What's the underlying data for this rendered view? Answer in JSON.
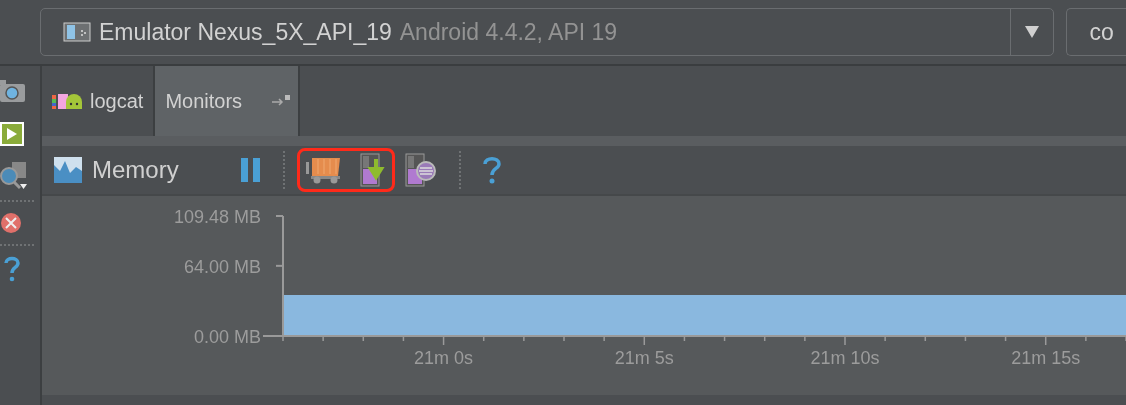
{
  "device_selector": {
    "name": "Emulator Nexus_5X_API_19",
    "detail": "Android 4.4.2, API 19"
  },
  "side_button": {
    "label": "co"
  },
  "tabs": [
    {
      "label": "logcat",
      "kind": "logcat",
      "selected": false
    },
    {
      "label": "Monitors",
      "kind": "monitors",
      "selected": true
    }
  ],
  "monitor": {
    "title": "Memory",
    "tools": [
      {
        "kind": "pause",
        "highlighted": false
      },
      {
        "kind": "gc",
        "highlighted": true
      },
      {
        "kind": "dump",
        "highlighted": true
      },
      {
        "kind": "alloc",
        "highlighted": false
      },
      {
        "kind": "help",
        "highlighted": false
      }
    ],
    "chart_data": {
      "type": "area",
      "categories": [
        null,
        null,
        null,
        null,
        "21m 0s",
        null,
        null,
        null,
        null,
        "21m 5s",
        null,
        null,
        null,
        null,
        "21m 10s",
        null,
        null,
        null,
        null,
        "21m 15s",
        null,
        null
      ],
      "series": [
        {
          "color": "#8ab8df",
          "values": [
            37.4,
            37.4,
            37.4,
            37.4,
            37.4,
            37.4,
            37.4,
            37.4,
            37.4,
            37.4,
            37.4,
            37.4,
            37.4,
            37.4,
            37.4,
            37.4,
            37.4,
            37.4,
            37.4,
            37.4,
            37.4,
            37.4
          ]
        }
      ],
      "ylim": [
        0,
        109.48
      ],
      "yticks": [
        {
          "value": 0,
          "label": "0.00 MB"
        },
        {
          "value": 64,
          "label": "64.00 MB"
        },
        {
          "value": 109.48,
          "label": "109.48 MB"
        }
      ]
    }
  }
}
